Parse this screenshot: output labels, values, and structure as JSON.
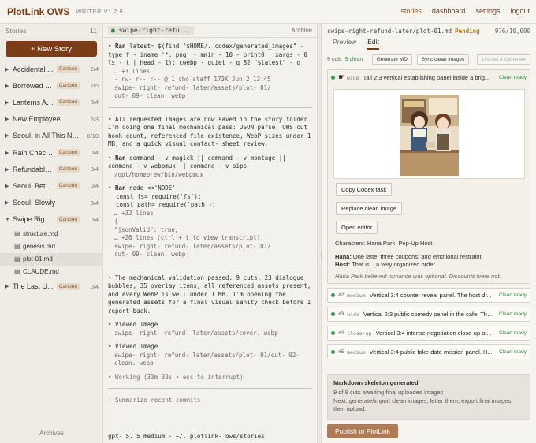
{
  "app": {
    "brand": "PlotLink OWS",
    "version": "WRITER V1.2.8"
  },
  "nav": [
    {
      "label": "stories",
      "active": true
    },
    {
      "label": "dashboard",
      "active": false
    },
    {
      "label": "settings",
      "active": false
    },
    {
      "label": "logout",
      "active": false
    }
  ],
  "sidebar": {
    "header": "Stories",
    "count": "11",
    "new_story": "+ New Story",
    "stories": [
      {
        "title": "Accidental ...",
        "tag": "Cartoon",
        "count": "2/4"
      },
      {
        "title": "Borrowed B...",
        "tag": "Cartoon",
        "count": "2/5"
      },
      {
        "title": "Lanterns Aft...",
        "tag": "Cartoon",
        "count": "0/4"
      },
      {
        "title": "New Employee",
        "tag": "",
        "count": "2/3"
      },
      {
        "title": "Seoul, in All This No...",
        "tag": "",
        "count": "8/10"
      },
      {
        "title": "Rain Check ...",
        "tag": "Cartoon",
        "count": "0/4"
      },
      {
        "title": "Refundable ...",
        "tag": "Cartoon",
        "count": "0/4"
      },
      {
        "title": "Seoul, Betw...",
        "tag": "Cartoon",
        "count": "0/4"
      },
      {
        "title": "Seoul, Slowly",
        "tag": "",
        "count": "3/4"
      },
      {
        "title": "Swipe Right...",
        "tag": "Cartoon",
        "count": "0/4",
        "expanded": true
      }
    ],
    "files": [
      {
        "name": "structure.md",
        "selected": false
      },
      {
        "name": "genesis.md",
        "selected": false
      },
      {
        "name": "plot-01.md",
        "selected": true
      },
      {
        "name": "CLAUDE.md",
        "selected": false
      }
    ],
    "last_story": {
      "title": "The Last U...",
      "tag": "Cartoon",
      "count": "0/4"
    },
    "archives": "Archives"
  },
  "middle": {
    "tab": "swipe-right-refu...",
    "archive": "Archive",
    "blocks": [
      {
        "label": "Ran",
        "cmd": "latest= $(find \"$HOME/. codex/generated_images\" - type f - iname '*. png' - mmin - 10 - print0 | xargs - 0 ls - t | head - 1); cwebp - quiet - q 82 \"$latest\" - o",
        "sub": [
          "… +3 lines",
          "- rw- r-- r-- @ 1 cho  staff  173K Jun  2 13:45",
          "swipe- right- refund- later/assets/plot- 01/",
          "cut- 09- clean. webp"
        ]
      },
      {
        "text": "All requested images are now saved in the story folder. I'm doing one final mechanical pass: JSON parse, OWS cut hook count, referenced file existence, WebP sizes under 1 MB, and a quick visual contact- sheet review."
      },
      {
        "label": "Ran",
        "cmd": "command - v magick || command - v montage || command - v webpmux || command - v sips",
        "sub": [
          "/opt/homebrew/bin/webpmux"
        ]
      },
      {
        "label": "Ran",
        "cmd": "node <<'NODE'",
        "code": [
          "const fs= require('fs');",
          "const path= require('path');"
        ],
        "sub2": [
          "… +32 lines",
          "{",
          "  \"jsonValid\": true,",
          "… +26 lines (ctrl + t to view transcript)",
          "swipe- right- refund- later/assets/plot- 01/",
          "cut- 09- clean. webp"
        ]
      },
      {
        "text": "The mechanical validation passed: 9 cuts, 23 dialogue bubbles, 35 overlay items, all referenced assets present, and every WebP is well under 1 MB. I'm opening the generated assets for a final visual sanity check before I report back."
      },
      {
        "label": "Viewed Image",
        "sub": [
          "swipe- right- refund- later/assets/cover. webp"
        ]
      },
      {
        "label": "Viewed Image",
        "sub": [
          "swipe- right- refund- later/assets/plot- 01/cut- 02- clean. webp"
        ]
      },
      {
        "working": "Working (33m 33s • esc to interrupt)"
      },
      {
        "summarize": "› Summarize recent commits"
      }
    ],
    "prompt": "gpt- 5. 5 medium · ~/. plotlink- ows/stories"
  },
  "right": {
    "file": "swipe-right-refund-later/plot-01.md",
    "status": "Pending",
    "chars": "976/10,000",
    "tabs": [
      {
        "label": "Preview",
        "active": false
      },
      {
        "label": "Edit",
        "active": true
      }
    ],
    "cuts_count": "9 cuts",
    "clean_count": "9 clean",
    "buttons": {
      "generate": "Generate MD",
      "sync": "Sync clean images",
      "upload": "Upload & Generate"
    },
    "expanded_cut": {
      "kind": "wide",
      "desc": "Tall 2:3 vertical establishing panel inside a brig...",
      "status": "Clean ready",
      "copy": "Copy Codex task",
      "replace": "Replace clean image",
      "open": "Open editor",
      "characters": "Characters: Hana Park, Pop-Up Host",
      "line1_name": "Hana:",
      "line1": " One latte, three coupons, and emotional restraint.",
      "line2_name": "Host:",
      "line2": " That is... a very organized order.",
      "note": "Hana Park believed romance was optional. Discounts were not."
    },
    "cuts": [
      {
        "num": "#2",
        "kind": "medium",
        "desc": "Vertical 3:4 counter reveal panel. The host dr...",
        "status": "Clean ready"
      },
      {
        "num": "#3",
        "kind": "wide",
        "desc": "Vertical 2:3 public comedy panel in the cafe. The h...",
        "status": "Clean ready"
      },
      {
        "num": "#4",
        "kind": "close-up",
        "desc": "Vertical 3:4 intense negotiation close-up at...",
        "status": "Clean ready"
      },
      {
        "num": "#5",
        "kind": "medium",
        "desc": "Vertical 3:4 public fake-date mission panel. H...",
        "status": "Clean ready"
      }
    ],
    "summary": {
      "title": "Markdown skeleton generated",
      "status": "9 of 9 cuts awaiting final uploaded images",
      "next": "Next: generate/import clean images, letter them, export final images, then upload."
    },
    "publish": "Publish to PlotLink"
  }
}
